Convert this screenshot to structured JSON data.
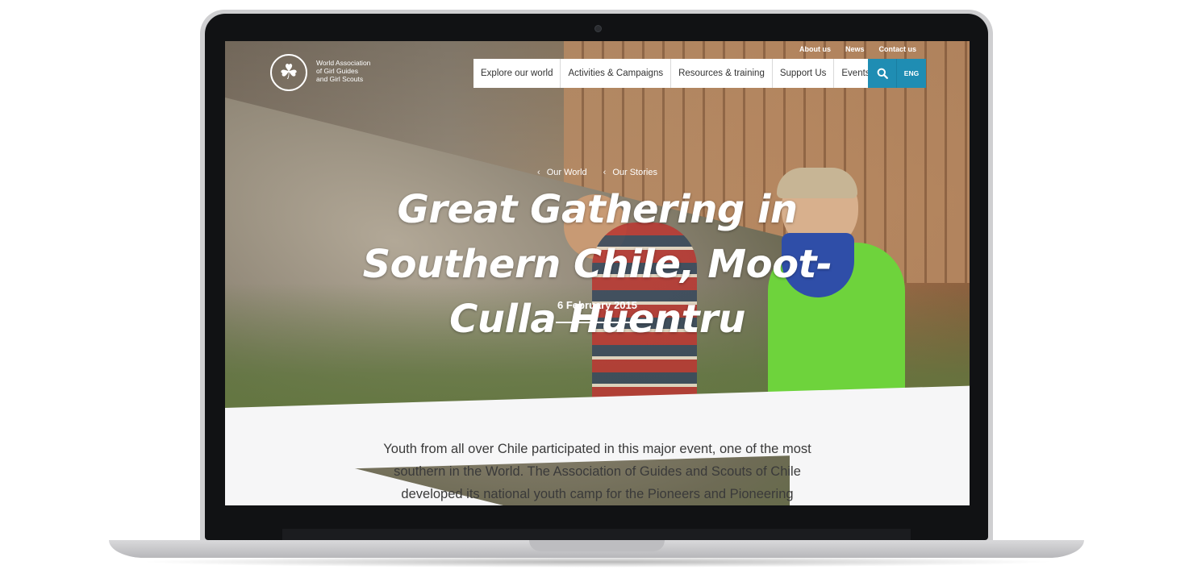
{
  "header": {
    "org_name_lines": [
      "World Association",
      "of Girl Guides",
      "and Girl Scouts"
    ],
    "logo_icon": "trefoil-icon",
    "top_links": [
      "About us",
      "News",
      "Contact us"
    ],
    "nav": [
      "Explore our world",
      "Activities & Campaigns",
      "Resources & training",
      "Support Us",
      "Events"
    ],
    "search_icon": "search-icon",
    "language": "ENG"
  },
  "breadcrumb": [
    "Our World",
    "Our Stories"
  ],
  "title": "Great Gathering in Southern Chile, Moot-Culla Huentru",
  "date": "6 February 2015",
  "intro": "Youth from all over Chile participated in this major event, one of the most southern in the World. The Association of Guides and Scouts of Chile developed its national youth camp for the Pioneers and Pioneering",
  "colors": {
    "accent": "#1f8db3",
    "nav_background": "#ffffff",
    "body_background": "#f6f6f7"
  }
}
